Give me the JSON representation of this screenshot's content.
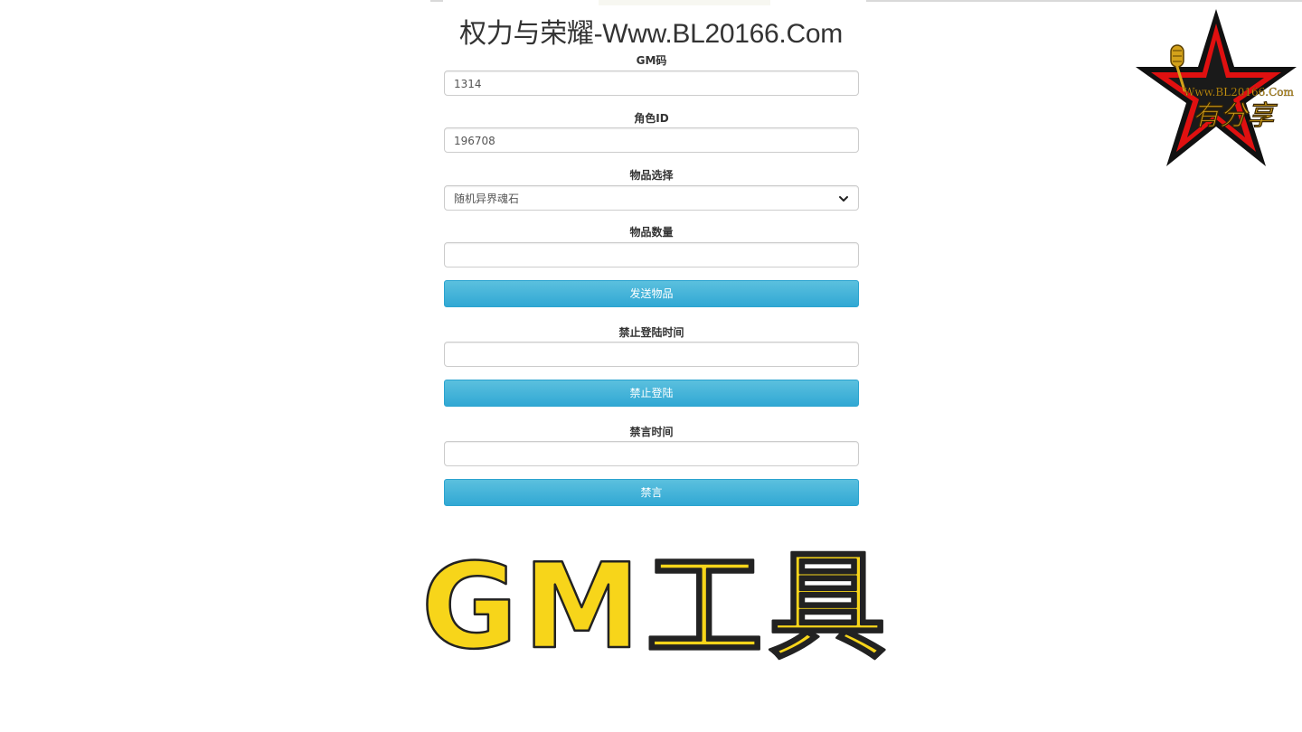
{
  "page": {
    "title": "权力与荣耀-Www.BL20166.Com"
  },
  "form": {
    "gm_code": {
      "label": "GM码",
      "value": "1314"
    },
    "role_id": {
      "label": "角色ID",
      "value": "196708"
    },
    "item_select": {
      "label": "物品选择",
      "selected": "随机异界魂石"
    },
    "item_count": {
      "label": "物品数量",
      "value": ""
    },
    "send_button": "发送物品",
    "ban_login_time": {
      "label": "禁止登陆时间",
      "value": ""
    },
    "ban_login_button": "禁止登陆",
    "mute_time": {
      "label": "禁言时间",
      "value": ""
    },
    "mute_button": "禁言"
  },
  "logo": {
    "url_text": "Www.BL20166.Com",
    "script_text": "有分享",
    "colors": {
      "star_outer": "#111111",
      "star_red": "#e01010",
      "text_gold": "#d4a21a"
    }
  },
  "banner": {
    "text": "GM工具",
    "fill_color": "#f7d51a",
    "outline_color": "#222222"
  },
  "colors": {
    "button": "#31a8d4",
    "border": "#cccccc"
  }
}
